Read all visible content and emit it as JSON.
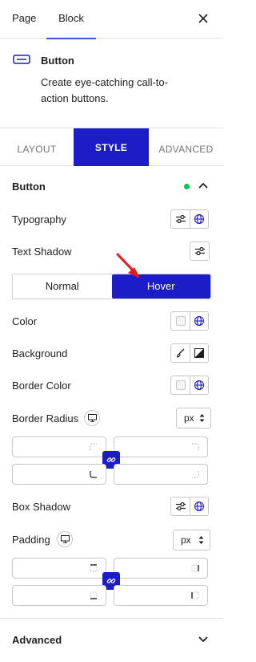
{
  "header": {
    "tabs": [
      {
        "label": "Page"
      },
      {
        "label": "Block"
      }
    ],
    "close_icon": "close-icon"
  },
  "block": {
    "icon": "button-icon",
    "title": "Button",
    "description": "Create eye-catching call-to-action buttons."
  },
  "mode_tabs": [
    {
      "label": "LAYOUT"
    },
    {
      "label": "STYLE",
      "active": true
    },
    {
      "label": "ADVANCED"
    }
  ],
  "button_section": {
    "title": "Button",
    "status_color": "#00c853",
    "typography_label": "Typography",
    "text_shadow_label": "Text Shadow",
    "state_toggle": {
      "normal": "Normal",
      "hover": "Hover",
      "active": "Hover"
    },
    "color_label": "Color",
    "background_label": "Background",
    "border_color_label": "Border Color",
    "border_radius": {
      "label": "Border Radius",
      "unit": "px"
    },
    "box_shadow_label": "Box Shadow",
    "padding": {
      "label": "Padding",
      "unit": "px"
    }
  },
  "advanced_section": {
    "title": "Advanced"
  },
  "colors": {
    "accent": "#1d1dc8",
    "tab_underline": "#3858e9",
    "status": "#00c853"
  }
}
